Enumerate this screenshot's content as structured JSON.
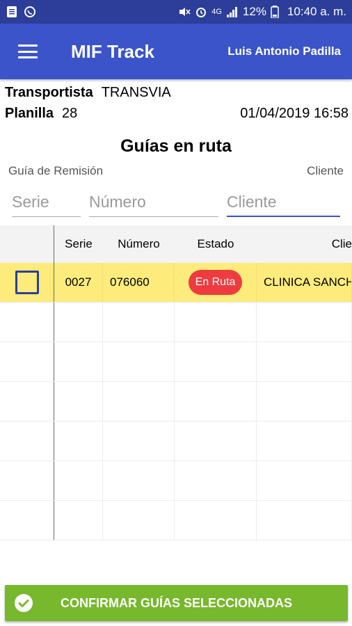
{
  "status_bar": {
    "left_icons": [
      "notification-icon",
      "whatsapp-icon"
    ],
    "right_icons": [
      "mute-icon",
      "alarm-icon",
      "4g-signal-icon",
      "battery-icon"
    ],
    "network": "4G",
    "battery": "12%",
    "time": "10:40 a. m."
  },
  "app_bar": {
    "title": "MIF Track",
    "user": "Luis Antonio Padilla"
  },
  "info": {
    "transportista_label": "Transportista",
    "transportista_value": "TRANSVIA",
    "planilla_label": "Planilla",
    "planilla_value": "28",
    "datetime": "01/04/2019 16:58"
  },
  "section": {
    "title": "Guías en ruta",
    "guia_label": "Guía de Remisión",
    "cliente_label": "Cliente"
  },
  "filters": {
    "serie_placeholder": "Serie",
    "numero_placeholder": "Número",
    "cliente_placeholder": "Cliente"
  },
  "table": {
    "headers": [
      "Serie",
      "Número",
      "Estado",
      "Clie"
    ],
    "rows": [
      {
        "serie": "0027",
        "numero": "076060",
        "estado": "En Ruta",
        "cliente": "CLINICA SANCH"
      }
    ]
  },
  "colors": {
    "primary": "#3b54c9",
    "status_bar": "#2c3e9a",
    "selected_row": "#fdeb7b",
    "badge": "#ef3b3f",
    "confirm": "#77b82c"
  },
  "confirm_button": {
    "label": "CONFIRMAR GUÍAS SELECCIONADAS"
  }
}
